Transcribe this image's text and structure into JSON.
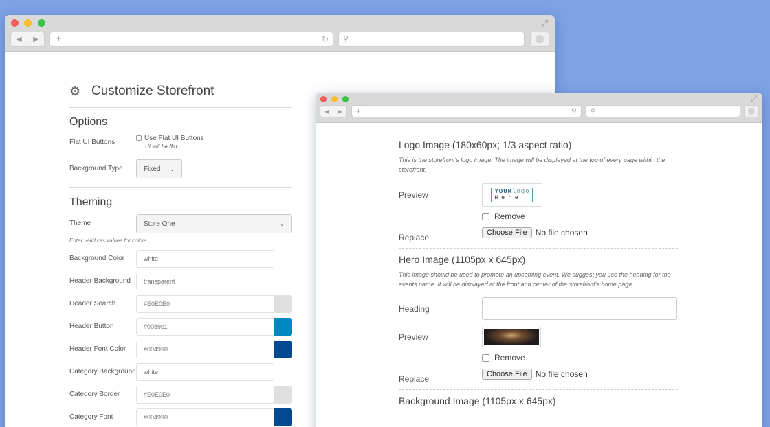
{
  "colors": {
    "background": "#7da2e6",
    "header_search_swatch": "#E0E0E0",
    "header_button_swatch": "#0089c1",
    "header_font_swatch": "#004990",
    "category_border_swatch": "#E0E0E0",
    "category_font_swatch": "#004990"
  },
  "icons": {
    "back": "◀",
    "forward": "▶",
    "new_tab": "+",
    "reload": "↻",
    "search": "⚲",
    "fullscreen": "⤢",
    "gears": "⚙",
    "chevron": "⌄"
  },
  "customize": {
    "title": "Customize Storefront",
    "options": {
      "heading": "Options",
      "flat_ui_label": "Flat UI Buttons",
      "flat_ui_checkbox_label": "Use Flat UI Buttons",
      "flat_ui_help_prefix": "UI will ",
      "flat_ui_help_bold": "be flat",
      "flat_ui_help_suffix": ".",
      "background_type_label": "Background Type",
      "background_type_value": "Fixed"
    },
    "theming": {
      "heading": "Theming",
      "theme_label": "Theme",
      "theme_value": "Store One",
      "help": "Enter valid css values for colors",
      "fields": [
        {
          "label": "Background Color",
          "value": "white"
        },
        {
          "label": "Header Background",
          "value": "transparent"
        },
        {
          "label": "Header Search",
          "value": "#E0E0E0"
        },
        {
          "label": "Header Button",
          "value": "#0089c1"
        },
        {
          "label": "Header Font Color",
          "value": "#004990"
        },
        {
          "label": "Category Background",
          "value": "white"
        },
        {
          "label": "Category Border",
          "value": "#E0E0E0"
        },
        {
          "label": "Category Font",
          "value": "#004990"
        }
      ]
    }
  },
  "images": {
    "logo": {
      "title": "Logo Image (180x60px; 1/3 aspect ratio)",
      "help": "This is the storefront's logo image. The image will be displayed at the top of every page within the storefront.",
      "preview_label": "Preview",
      "logo_line1_a": "YOUR",
      "logo_line1_b": "logo",
      "logo_line2": "Here",
      "remove_label": "Remove",
      "replace_label": "Replace",
      "choose_file": "Choose File",
      "no_file": "No file chosen"
    },
    "hero": {
      "title": "Hero Image (1105px x 645px)",
      "help": "This image should be used to promote an upcoming event. We suggest you use the heading for the events name. It will be displayed at the front and center of the storefront's home page.",
      "heading_label": "Heading",
      "preview_label": "Preview",
      "remove_label": "Remove",
      "replace_label": "Replace",
      "choose_file": "Choose File",
      "no_file": "No file chosen"
    },
    "background": {
      "title": "Background Image (1105px x 645px)"
    }
  }
}
